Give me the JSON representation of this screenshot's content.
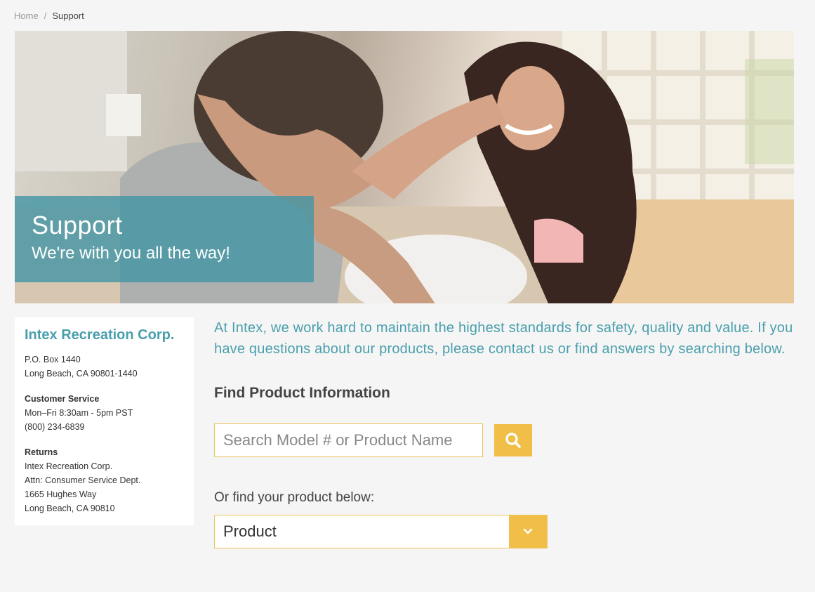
{
  "breadcrumb": {
    "home": "Home",
    "separator": "/",
    "current": "Support"
  },
  "hero": {
    "title": "Support",
    "subtitle": "We're with you all the way!"
  },
  "contact_card": {
    "company": "Intex Recreation Corp.",
    "address_line1": "P.O. Box 1440",
    "address_line2": "Long Beach, CA 90801-1440",
    "customer_service_label": "Customer Service",
    "hours": "Mon–Fri 8:30am - 5pm PST",
    "phone": "(800) 234-6839",
    "returns_label": "Returns",
    "returns_line1": "Intex Recreation Corp.",
    "returns_line2": "Attn: Consumer Service Dept.",
    "returns_line3": "1665 Hughes Way",
    "returns_line4": "Long Beach, CA 90810"
  },
  "main": {
    "intro": "At Intex, we work hard to maintain the highest standards for safety, quality and value. If you have questions about our products, please contact us or find answers by searching below.",
    "find_heading": "Find Product Information",
    "search": {
      "placeholder": "Search Model # or Product Name",
      "value": ""
    },
    "or_label": "Or find your product below:",
    "product_select": {
      "selected": "Product"
    }
  },
  "colors": {
    "accent_teal": "#4a9fad",
    "accent_yellow": "#f1be48",
    "page_bg": "#f5f5f5"
  },
  "icons": {
    "search": "search-icon",
    "dropdown": "chevron-down-icon"
  }
}
